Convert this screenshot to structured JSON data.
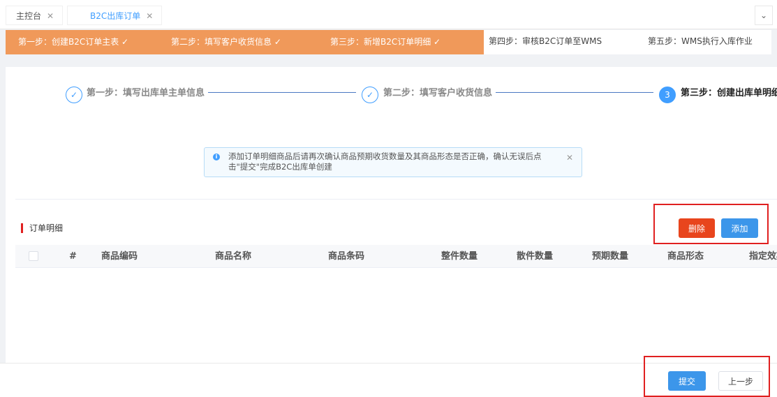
{
  "tabs": [
    {
      "label": "主控台",
      "close": "✕"
    },
    {
      "label": "B2C出库订单",
      "close": "✕"
    }
  ],
  "tab_dropdown_icon": "⌄",
  "workflow": {
    "steps": [
      {
        "label": "第一步：创建B2C订单主表 ✓",
        "done": true
      },
      {
        "label": "第二步：填写客户收货信息 ✓",
        "done": true
      },
      {
        "label": "第三步：新增B2C订单明细 ✓",
        "done": true
      },
      {
        "label": "第四步：审核B2C订单至WMS",
        "done": false
      },
      {
        "label": "第五步：WMS执行入库作业",
        "done": false
      }
    ],
    "done_color": "#f0995a"
  },
  "stepper": {
    "steps": [
      {
        "icon": "✓",
        "label": "第一步：填写出库单主单信息"
      },
      {
        "icon": "✓",
        "label": "第二步：填写客户收货信息"
      },
      {
        "icon": "3",
        "label": "第三步：创建出库单明细"
      }
    ]
  },
  "alert": {
    "icon": "i",
    "text": "添加订单明细商品后请再次确认商品预期收货数量及其商品形态是否正确，确认无误后点击\"提交\"完成B2C出库单创建",
    "close": "✕"
  },
  "section": {
    "title": "订单明细",
    "delete_label": "删除",
    "add_label": "添加"
  },
  "table": {
    "columns": [
      "#",
      "商品编码",
      "商品名称",
      "商品条码",
      "整件数量",
      "散件数量",
      "预期数量",
      "商品形态",
      "指定效期"
    ]
  },
  "footer": {
    "submit_label": "提交",
    "prev_label": "上一步"
  },
  "colors": {
    "primary": "#3c96ea",
    "danger": "#e8451d",
    "highlight": "#e02020"
  }
}
